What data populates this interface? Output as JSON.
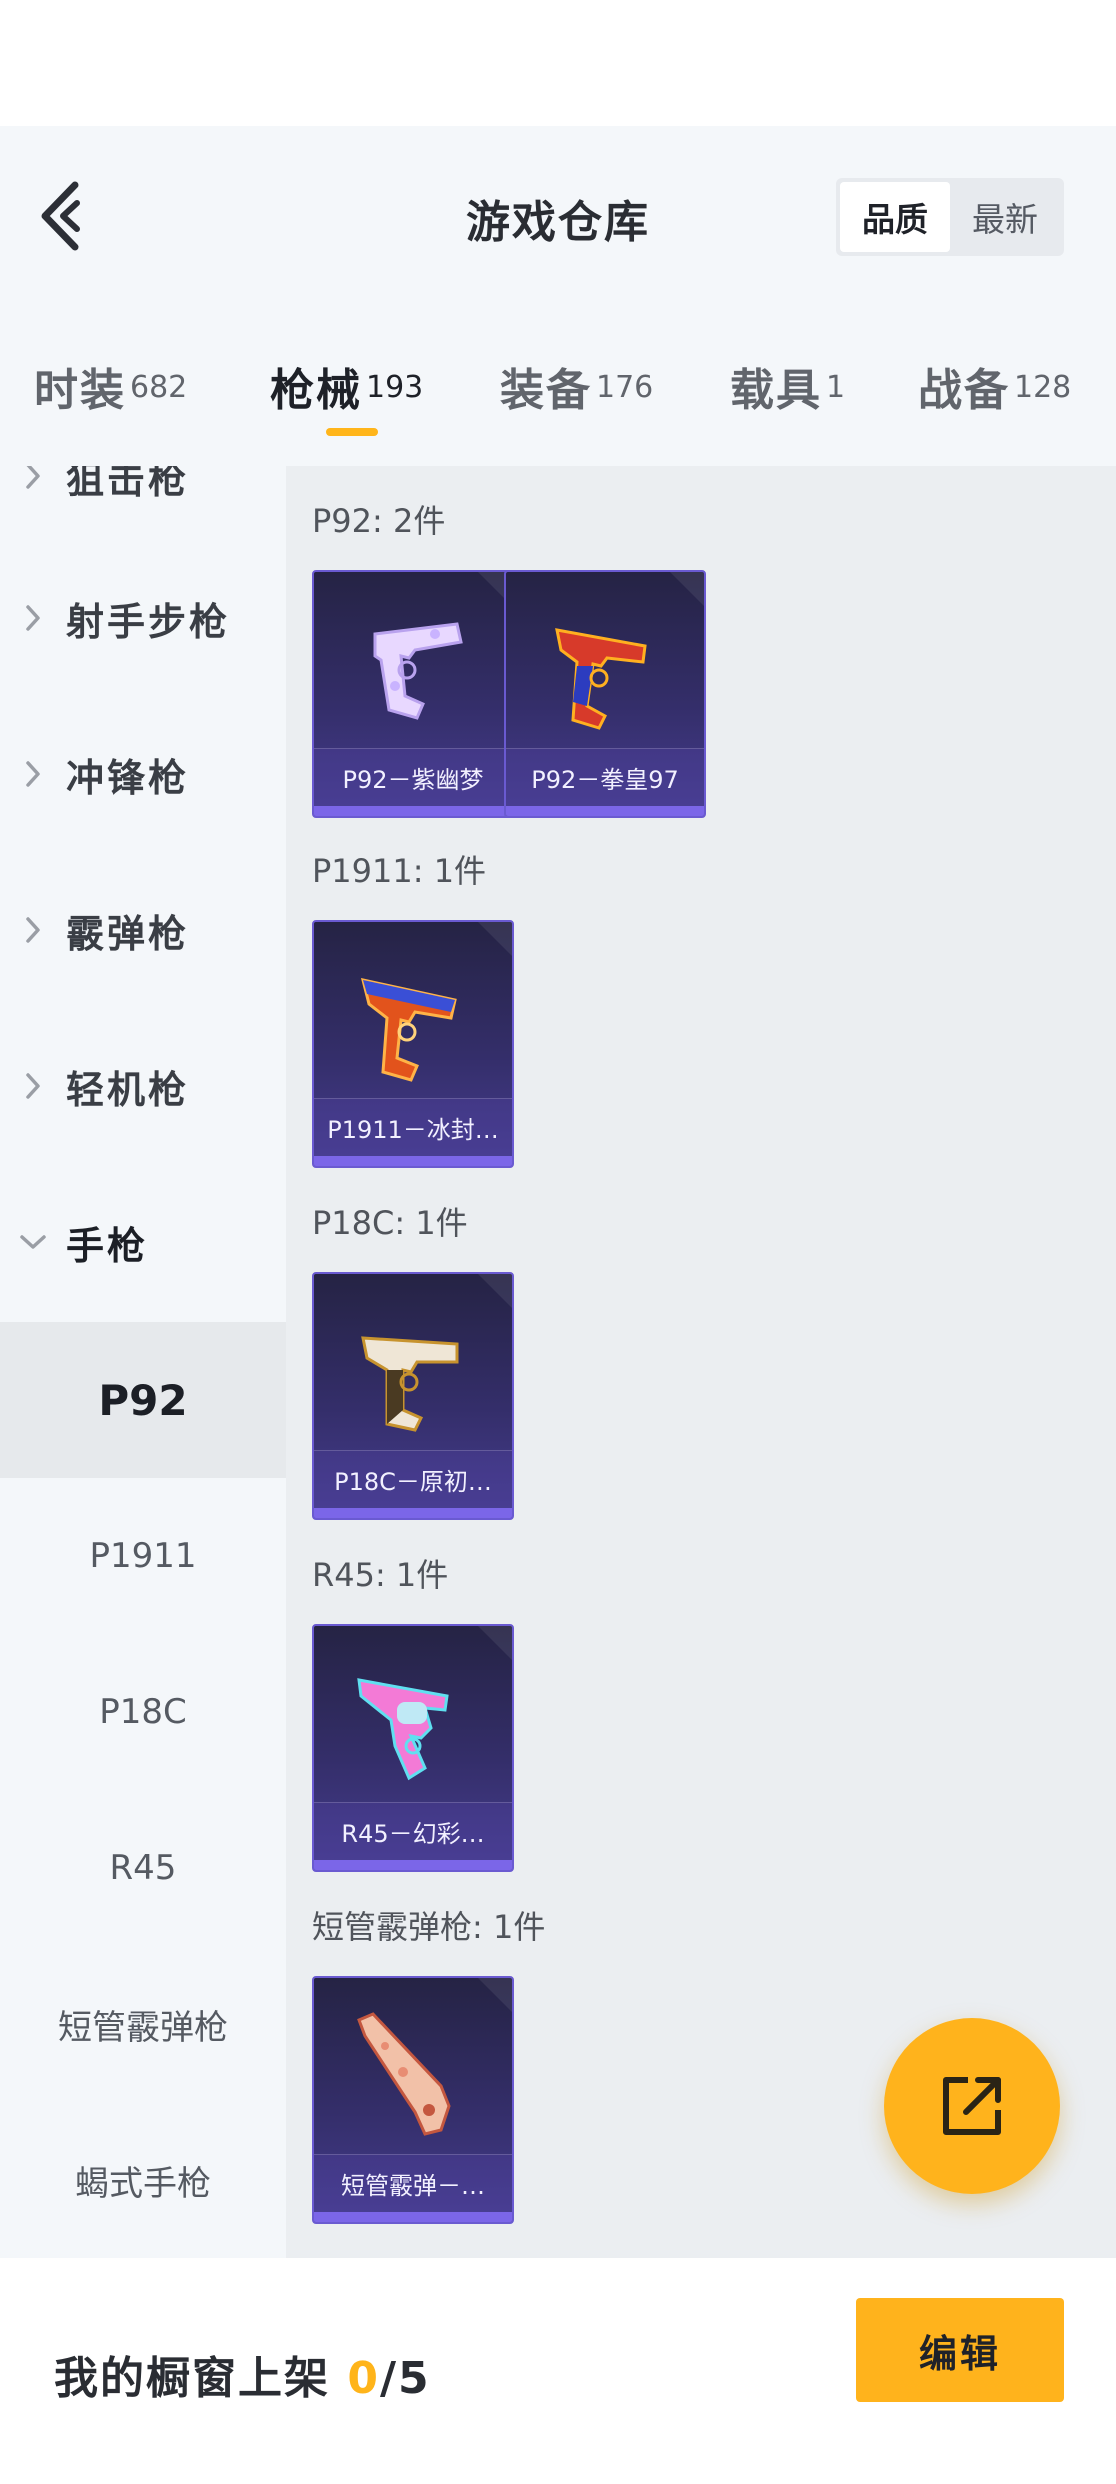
{
  "header": {
    "title": "游戏仓库",
    "sort_options": [
      "品质",
      "最新"
    ],
    "active_sort": "品质"
  },
  "tabs": [
    {
      "label": "时装",
      "count": "682"
    },
    {
      "label": "枪械",
      "count": "193",
      "active": true
    },
    {
      "label": "装备",
      "count": "176"
    },
    {
      "label": "载具",
      "count": "1"
    },
    {
      "label": "战备",
      "count": "128"
    }
  ],
  "sidebar": {
    "categories": [
      {
        "label": "狙击枪"
      },
      {
        "label": "射手步枪"
      },
      {
        "label": "冲锋枪"
      },
      {
        "label": "霰弹枪"
      },
      {
        "label": "轻机枪"
      },
      {
        "label": "手枪"
      }
    ],
    "subitems": [
      {
        "label": "P92",
        "active": true
      },
      {
        "label": "P1911"
      },
      {
        "label": "P18C"
      },
      {
        "label": "R45"
      },
      {
        "label": "短管霰弹枪"
      },
      {
        "label": "蝎式手枪"
      }
    ]
  },
  "groups": [
    {
      "title": "P92: 2件",
      "items": [
        {
          "name": "P92－紫幽梦",
          "icon": "pistol-purple-floral"
        },
        {
          "name": "P92－拳皇97",
          "icon": "pistol-red-blue"
        }
      ]
    },
    {
      "title": "P1911: 1件",
      "items": [
        {
          "name": "P1911－冰封…",
          "icon": "pistol-fire-ice"
        }
      ]
    },
    {
      "title": "P18C: 1件",
      "items": [
        {
          "name": "P18C－原初…",
          "icon": "pistol-gold-white"
        }
      ]
    },
    {
      "title": "R45: 1件",
      "items": [
        {
          "name": "R45－幻彩…",
          "icon": "revolver-pink-cyan"
        }
      ]
    },
    {
      "title": "短管霰弹枪: 1件",
      "items": [
        {
          "name": "短管霰弹－…",
          "icon": "sawed-off-shotgun-floral"
        }
      ]
    }
  ],
  "footer": {
    "showcase_label": "我的橱窗上架",
    "showcase_used": "0",
    "showcase_total": "/5",
    "edit_label": "编辑"
  },
  "colors": {
    "accent": "#ffb31c",
    "card_border": "#6a5ad1",
    "card_bg": "#342e6a"
  },
  "icons": [
    "back-arrow-icon",
    "chevron-right-icon",
    "chevron-down-icon",
    "share-external-icon"
  ]
}
